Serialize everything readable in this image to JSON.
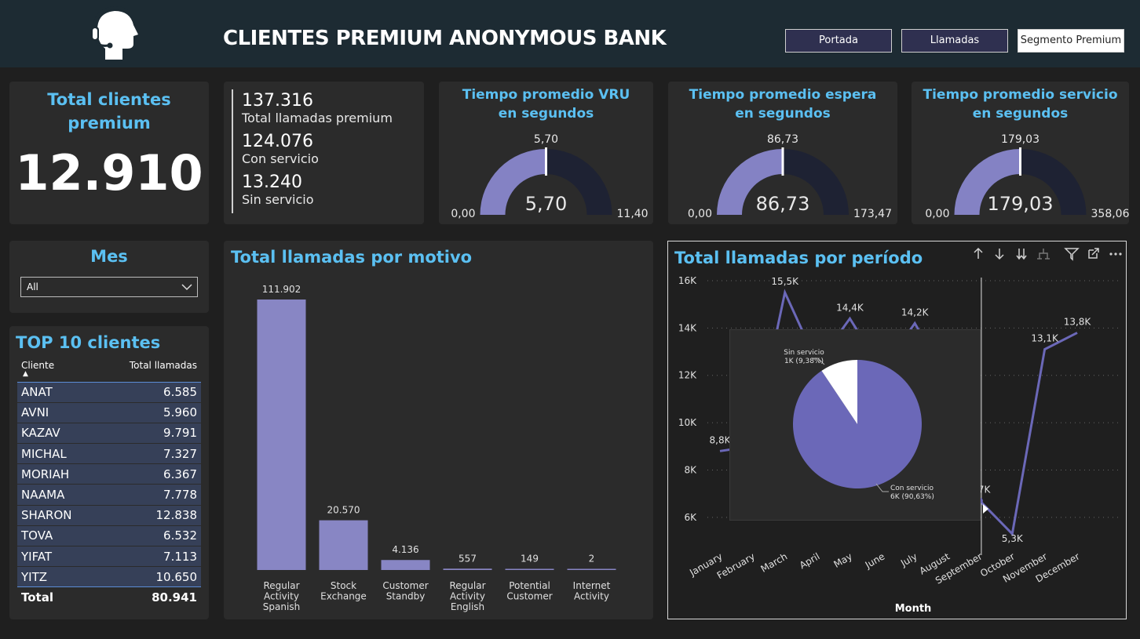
{
  "header": {
    "title": "CLIENTES PREMIUM ANONYMOUS BANK",
    "logo_icon": "headset-support-icon",
    "nav": [
      {
        "label": "Portada",
        "active": false
      },
      {
        "label": "Llamadas",
        "active": false
      },
      {
        "label": "Segmento Premium",
        "active": true
      }
    ]
  },
  "kpi_total": {
    "title": "Total clientes premium",
    "value": "12.910"
  },
  "calls_stats": [
    {
      "value": "137.316",
      "label": "Total llamadas premium"
    },
    {
      "value": "124.076",
      "label": "Con servicio"
    },
    {
      "value": "13.240",
      "label": "Sin servicio"
    }
  ],
  "gauges": [
    {
      "title": "Tiempo promedio VRU en segundos",
      "value": 5.7,
      "value_label": "5,70",
      "min_label": "0,00",
      "max_label": "11,40",
      "target_label": "5,70",
      "max": 11.4
    },
    {
      "title": "Tiempo promedio espera en segundos",
      "value": 86.73,
      "value_label": "86,73",
      "min_label": "0,00",
      "max_label": "173,47",
      "target_label": "86,73",
      "max": 173.47
    },
    {
      "title": "Tiempo promedio servicio en segundos",
      "value": 179.03,
      "value_label": "179,03",
      "min_label": "0,00",
      "max_label": "358,06",
      "target_label": "179,03",
      "max": 358.06
    }
  ],
  "mes_slicer": {
    "title": "Mes",
    "selected": "All"
  },
  "top_clients": {
    "title": "TOP 10 clientes",
    "col_client": "Cliente",
    "col_calls": "Total llamadas",
    "rows": [
      {
        "name": "ANAT",
        "value": "6.585"
      },
      {
        "name": "AVNI",
        "value": "5.960"
      },
      {
        "name": "KAZAV",
        "value": "9.791"
      },
      {
        "name": "MICHAL",
        "value": "7.327"
      },
      {
        "name": "MORIAH",
        "value": "6.367"
      },
      {
        "name": "NAAMA",
        "value": "7.778"
      },
      {
        "name": "SHARON",
        "value": "12.838"
      },
      {
        "name": "TOVA",
        "value": "6.532"
      },
      {
        "name": "YIFAT",
        "value": "7.113"
      },
      {
        "name": "YITZ",
        "value": "10.650"
      }
    ],
    "total_label": "Total",
    "total_value": "80.941"
  },
  "colors": {
    "accent": "#5bc0f2",
    "bar": "#8886c4",
    "line": "#6b68b8",
    "gauge_fill": "#8482c4",
    "gauge_track": "#1e2233"
  },
  "chart_data": [
    {
      "type": "bar",
      "title": "Total llamadas por motivo",
      "categories": [
        "Regular Activity Spanish",
        "Stock Exchange",
        "Customer Standby",
        "Regular Activity English",
        "Potential Customer",
        "Internet Activity"
      ],
      "values": [
        111902,
        20570,
        4136,
        557,
        149,
        2
      ],
      "data_labels": [
        "111.902",
        "20.570",
        "4.136",
        "557",
        "149",
        "2"
      ]
    },
    {
      "type": "line",
      "title": "Total llamadas por período",
      "xlabel": "Month",
      "categories": [
        "January",
        "February",
        "March",
        "April",
        "May",
        "June",
        "July",
        "August",
        "September",
        "October",
        "November",
        "December"
      ],
      "values": [
        8800,
        9000,
        15500,
        12500,
        14400,
        12200,
        14200,
        11800,
        6700,
        5300,
        13100,
        13800
      ],
      "visible_labels": {
        "January": "8,8K",
        "March": "15,5K",
        "May": "14,4K",
        "July": "14,2K",
        "September": "6,7K",
        "October": "5,3K",
        "November": "13,1K",
        "December": "13,8K"
      },
      "ylim": [
        5000,
        16000
      ],
      "yticks": [
        "16K",
        "14K",
        "12K",
        "10K",
        "8K",
        "6K"
      ],
      "ytick_values": [
        16000,
        14000,
        12000,
        10000,
        8000,
        6000
      ],
      "grid": true
    },
    {
      "type": "pie",
      "slices": [
        {
          "name": "Con servicio",
          "value": 6000,
          "label": "6K (90,63%)",
          "percent": 90.63
        },
        {
          "name": "Sin servicio",
          "value": 1000,
          "label": "1K (9,38%)",
          "percent": 9.38
        }
      ]
    }
  ],
  "visual_toolbar_icons": [
    "arrow-up-icon",
    "arrow-down-icon",
    "double-arrow-down-icon",
    "hierarchy-icon",
    "filter-icon",
    "focus-mode-icon",
    "more-options-icon"
  ]
}
